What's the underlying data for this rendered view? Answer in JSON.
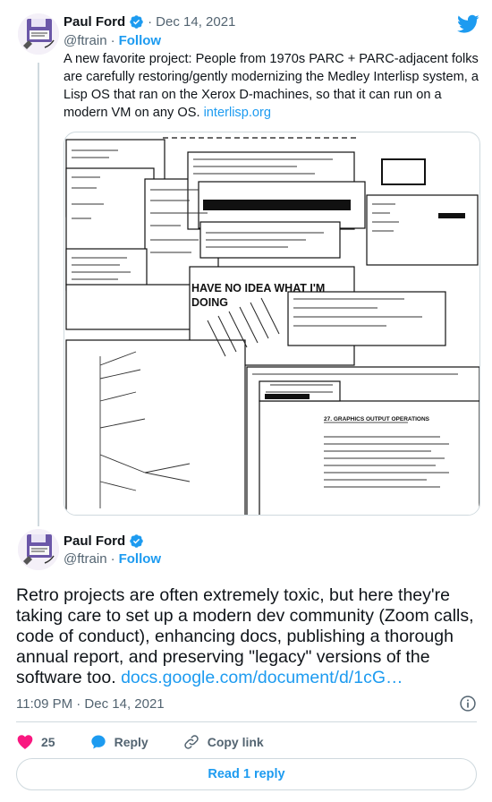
{
  "quoted_tweet": {
    "author": "Paul Ford",
    "date": "Dec 14, 2021",
    "separator": "·",
    "handle": "@ftrain",
    "follow_label": "Follow",
    "text": "A new favorite project: People from 1970s PARC + PARC-adjacent folks are carefully restoring/gently modernizing the Medley Interlisp system, a Lisp OS that ran on the Xerox D-machines, so that it can run on a modern VM on any OS.",
    "link": "interlisp.org",
    "media": {
      "caption_text": "HAVE NO IDEA WHAT I'M DOING",
      "section_heading": "27. GRAPHICS OUTPUT OPERATIONS"
    }
  },
  "main_tweet": {
    "author": "Paul Ford",
    "handle": "@ftrain",
    "follow_label": "Follow",
    "text": "Retro projects are often extremely toxic, but here they're taking care to set up a modern dev community (Zoom calls, code of conduct), enhancing docs, publishing a thorough annual report, and preserving \"legacy\" versions of the software too.",
    "link": "docs.google.com/document/d/1cG…",
    "timestamp": "11:09 PM · Dec 14, 2021"
  },
  "actions": {
    "like_count": "25",
    "reply_label": "Reply",
    "copy_link_label": "Copy link"
  },
  "read_replies_label": "Read 1 reply",
  "colors": {
    "accent": "#1d9bf0",
    "like": "#f91880",
    "muted": "#536471",
    "border": "#cfd9de"
  },
  "icons": [
    "twitter-bird-icon",
    "verified-badge-icon",
    "info-icon",
    "heart-icon",
    "reply-bubble-icon",
    "link-icon"
  ]
}
